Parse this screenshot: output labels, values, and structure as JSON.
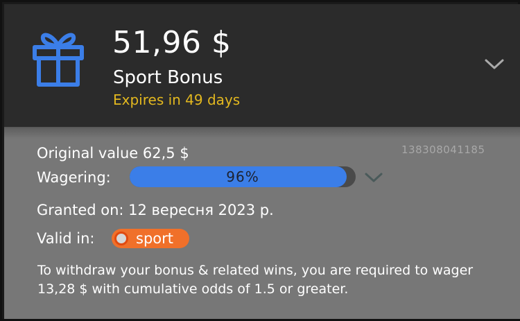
{
  "header": {
    "amount": "51,96 $",
    "bonus_name": "Sport Bonus",
    "expires": "Expires in 49 days",
    "icon": "gift-icon",
    "expand_icon": "chevron-down-icon"
  },
  "details": {
    "original_value": "Original value 62,5 $",
    "reference_id": "138308041185",
    "wagering_label": "Wagering:",
    "wagering_percent": 96,
    "wagering_text": "96%",
    "granted_on": "Granted on: 12 вересня 2023 р.",
    "valid_in_label": "Valid in:",
    "valid_in_tag": "sport",
    "note": "To withdraw your bonus & related wins, you are required to wager 13,28 $ with cumulative odds of 1.5 or greater."
  },
  "colors": {
    "accent": "#3b7ee8",
    "expires": "#e3b81f",
    "tag": "#f0702a",
    "header_bg": "#2b2b2b",
    "body_bg": "#777777"
  }
}
